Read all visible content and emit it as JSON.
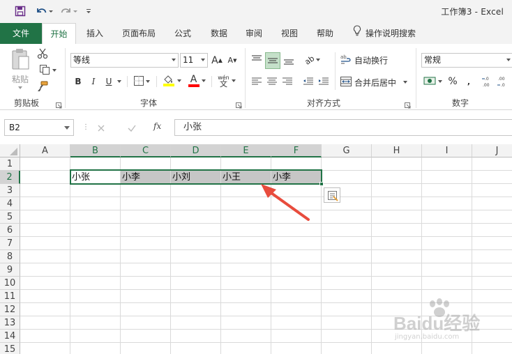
{
  "titlebar": {
    "document_title": "工作簿3  -  Excel"
  },
  "ribbon_tabs": [
    {
      "label": "文件"
    },
    {
      "label": "开始"
    },
    {
      "label": "插入"
    },
    {
      "label": "页面布局"
    },
    {
      "label": "公式"
    },
    {
      "label": "数据"
    },
    {
      "label": "审阅"
    },
    {
      "label": "视图"
    },
    {
      "label": "帮助"
    },
    {
      "label": "操作说明搜索"
    }
  ],
  "ribbon": {
    "clipboard": {
      "paste_label": "粘贴",
      "group_label": "剪贴板"
    },
    "font": {
      "font_name": "等线",
      "font_size": "11",
      "bold": "B",
      "italic": "I",
      "underline": "U",
      "group_label": "字体",
      "phonetic": "wén"
    },
    "alignment": {
      "wrap_text": "自动换行",
      "merge_center": "合并后居中",
      "group_label": "对齐方式"
    },
    "number": {
      "format": "常规",
      "percent": "%",
      "group_label": "数字"
    }
  },
  "formula_bar": {
    "name_box": "B2",
    "fx": "fx",
    "value": "小张"
  },
  "sheet": {
    "columns": [
      "A",
      "B",
      "C",
      "D",
      "E",
      "F",
      "G",
      "H",
      "I",
      "J"
    ],
    "rows": [
      "1",
      "2",
      "3",
      "4",
      "5",
      "6",
      "7",
      "8",
      "9",
      "10",
      "11",
      "12",
      "13",
      "14",
      "15"
    ],
    "row2": [
      "小张",
      "小李",
      "小刘",
      "小王",
      "小李"
    ],
    "selected_range": "B2:F2",
    "active_cell": "B2"
  },
  "watermark": {
    "brand": "Baidu经验",
    "url": "jingyan.baidu.com"
  },
  "colors": {
    "excel_green": "#217346",
    "annotation_arrow": "#e84c3d",
    "selection_fill": "#c6c6c6"
  }
}
